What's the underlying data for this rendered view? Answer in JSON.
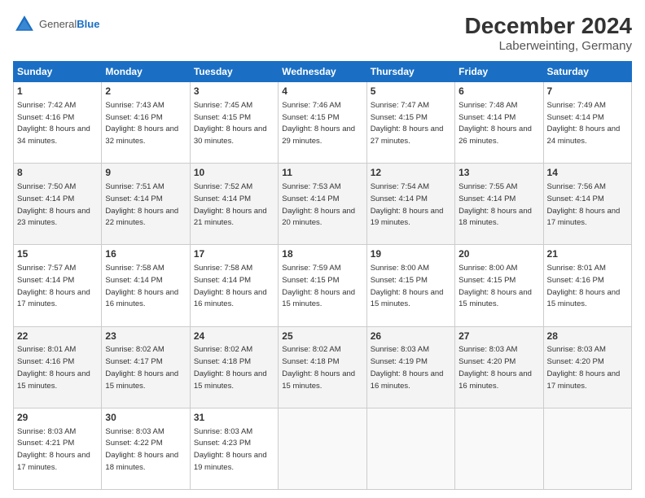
{
  "header": {
    "logo_general": "General",
    "logo_blue": "Blue",
    "title": "December 2024",
    "subtitle": "Laberweinting, Germany"
  },
  "days_of_week": [
    "Sunday",
    "Monday",
    "Tuesday",
    "Wednesday",
    "Thursday",
    "Friday",
    "Saturday"
  ],
  "weeks": [
    [
      {
        "day": "1",
        "sunrise": "7:42 AM",
        "sunset": "4:16 PM",
        "daylight": "8 hours and 34 minutes."
      },
      {
        "day": "2",
        "sunrise": "7:43 AM",
        "sunset": "4:16 PM",
        "daylight": "8 hours and 32 minutes."
      },
      {
        "day": "3",
        "sunrise": "7:45 AM",
        "sunset": "4:15 PM",
        "daylight": "8 hours and 30 minutes."
      },
      {
        "day": "4",
        "sunrise": "7:46 AM",
        "sunset": "4:15 PM",
        "daylight": "8 hours and 29 minutes."
      },
      {
        "day": "5",
        "sunrise": "7:47 AM",
        "sunset": "4:15 PM",
        "daylight": "8 hours and 27 minutes."
      },
      {
        "day": "6",
        "sunrise": "7:48 AM",
        "sunset": "4:14 PM",
        "daylight": "8 hours and 26 minutes."
      },
      {
        "day": "7",
        "sunrise": "7:49 AM",
        "sunset": "4:14 PM",
        "daylight": "8 hours and 24 minutes."
      }
    ],
    [
      {
        "day": "8",
        "sunrise": "7:50 AM",
        "sunset": "4:14 PM",
        "daylight": "8 hours and 23 minutes."
      },
      {
        "day": "9",
        "sunrise": "7:51 AM",
        "sunset": "4:14 PM",
        "daylight": "8 hours and 22 minutes."
      },
      {
        "day": "10",
        "sunrise": "7:52 AM",
        "sunset": "4:14 PM",
        "daylight": "8 hours and 21 minutes."
      },
      {
        "day": "11",
        "sunrise": "7:53 AM",
        "sunset": "4:14 PM",
        "daylight": "8 hours and 20 minutes."
      },
      {
        "day": "12",
        "sunrise": "7:54 AM",
        "sunset": "4:14 PM",
        "daylight": "8 hours and 19 minutes."
      },
      {
        "day": "13",
        "sunrise": "7:55 AM",
        "sunset": "4:14 PM",
        "daylight": "8 hours and 18 minutes."
      },
      {
        "day": "14",
        "sunrise": "7:56 AM",
        "sunset": "4:14 PM",
        "daylight": "8 hours and 17 minutes."
      }
    ],
    [
      {
        "day": "15",
        "sunrise": "7:57 AM",
        "sunset": "4:14 PM",
        "daylight": "8 hours and 17 minutes."
      },
      {
        "day": "16",
        "sunrise": "7:58 AM",
        "sunset": "4:14 PM",
        "daylight": "8 hours and 16 minutes."
      },
      {
        "day": "17",
        "sunrise": "7:58 AM",
        "sunset": "4:14 PM",
        "daylight": "8 hours and 16 minutes."
      },
      {
        "day": "18",
        "sunrise": "7:59 AM",
        "sunset": "4:15 PM",
        "daylight": "8 hours and 15 minutes."
      },
      {
        "day": "19",
        "sunrise": "8:00 AM",
        "sunset": "4:15 PM",
        "daylight": "8 hours and 15 minutes."
      },
      {
        "day": "20",
        "sunrise": "8:00 AM",
        "sunset": "4:15 PM",
        "daylight": "8 hours and 15 minutes."
      },
      {
        "day": "21",
        "sunrise": "8:01 AM",
        "sunset": "4:16 PM",
        "daylight": "8 hours and 15 minutes."
      }
    ],
    [
      {
        "day": "22",
        "sunrise": "8:01 AM",
        "sunset": "4:16 PM",
        "daylight": "8 hours and 15 minutes."
      },
      {
        "day": "23",
        "sunrise": "8:02 AM",
        "sunset": "4:17 PM",
        "daylight": "8 hours and 15 minutes."
      },
      {
        "day": "24",
        "sunrise": "8:02 AM",
        "sunset": "4:18 PM",
        "daylight": "8 hours and 15 minutes."
      },
      {
        "day": "25",
        "sunrise": "8:02 AM",
        "sunset": "4:18 PM",
        "daylight": "8 hours and 15 minutes."
      },
      {
        "day": "26",
        "sunrise": "8:03 AM",
        "sunset": "4:19 PM",
        "daylight": "8 hours and 16 minutes."
      },
      {
        "day": "27",
        "sunrise": "8:03 AM",
        "sunset": "4:20 PM",
        "daylight": "8 hours and 16 minutes."
      },
      {
        "day": "28",
        "sunrise": "8:03 AM",
        "sunset": "4:20 PM",
        "daylight": "8 hours and 17 minutes."
      }
    ],
    [
      {
        "day": "29",
        "sunrise": "8:03 AM",
        "sunset": "4:21 PM",
        "daylight": "8 hours and 17 minutes."
      },
      {
        "day": "30",
        "sunrise": "8:03 AM",
        "sunset": "4:22 PM",
        "daylight": "8 hours and 18 minutes."
      },
      {
        "day": "31",
        "sunrise": "8:03 AM",
        "sunset": "4:23 PM",
        "daylight": "8 hours and 19 minutes."
      },
      null,
      null,
      null,
      null
    ]
  ]
}
